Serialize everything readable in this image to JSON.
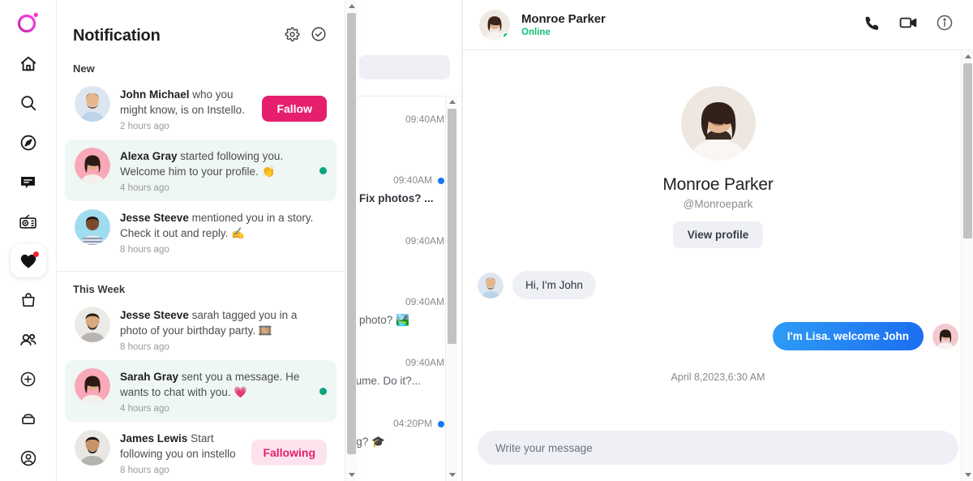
{
  "app": {
    "logo": "instello-logo",
    "accent": "#e51f6e",
    "unread_dot": "#0aa47e"
  },
  "rail": {
    "items": [
      {
        "name": "home",
        "icon": "home-icon",
        "badge": false
      },
      {
        "name": "search",
        "icon": "search-icon",
        "badge": false
      },
      {
        "name": "explore",
        "icon": "compass-icon",
        "badge": false
      },
      {
        "name": "messages",
        "icon": "chat-bubble-icon",
        "badge": false
      },
      {
        "name": "reels",
        "icon": "radio-icon",
        "badge": false
      },
      {
        "name": "notifications",
        "icon": "heart-icon",
        "badge": true
      },
      {
        "name": "shop",
        "icon": "shopping-bag-icon",
        "badge": false
      },
      {
        "name": "friends",
        "icon": "people-icon",
        "badge": false
      },
      {
        "name": "create",
        "icon": "plus-circle-icon",
        "badge": false
      },
      {
        "name": "saved",
        "icon": "archive-icon",
        "badge": false
      },
      {
        "name": "profile",
        "icon": "user-circle-icon",
        "badge": false
      }
    ]
  },
  "notification": {
    "title": "Notification",
    "settings_icon": "gear-icon",
    "markall_icon": "check-circle-icon",
    "sections": [
      {
        "label": "New",
        "items": [
          {
            "name": "John Michael",
            "text": " who you might know, is on Instello.",
            "time": "2 hours ago",
            "unread": false,
            "action": "Fallow",
            "action_type": "follow",
            "avatar": "avatar-john-michael"
          },
          {
            "name": "Alexa Gray",
            "text": " started following you. Welcome him to your profile. 👏",
            "time": "4 hours ago",
            "unread": true,
            "action": "",
            "action_type": "dot",
            "avatar": "avatar-alexa-gray"
          },
          {
            "name": "Jesse Steeve",
            "text": " mentioned you in a story. Check it out and reply. ✍️",
            "time": "8 hours ago",
            "unread": false,
            "action": "",
            "action_type": "none",
            "avatar": "avatar-jesse-steeve-1"
          }
        ]
      },
      {
        "label": "This Week",
        "items": [
          {
            "name": "Jesse Steeve",
            "text": " sarah tagged you in a photo of your birthday party. 🎞️",
            "time": "8 hours ago",
            "unread": false,
            "action": "",
            "action_type": "none",
            "avatar": "avatar-jesse-steeve-2"
          },
          {
            "name": "Sarah Gray",
            "text": " sent you a message. He wants to chat with you. 💗",
            "time": "4 hours ago",
            "unread": true,
            "action": "",
            "action_type": "dot",
            "avatar": "avatar-sarah-gray"
          },
          {
            "name": "James Lewis",
            "text": " Start following you on instello",
            "time": "8 hours ago",
            "unread": false,
            "action": "Fallowing",
            "action_type": "following",
            "avatar": "avatar-james-lewis"
          }
        ]
      }
    ]
  },
  "chat_list": {
    "search_placeholder": "",
    "items": [
      {
        "time": "09:40AM",
        "preview": "",
        "unread": false
      },
      {
        "time": "09:40AM",
        "preview": "Fix photos? ...",
        "unread": true
      },
      {
        "time": "09:40AM",
        "preview": "",
        "unread": false
      },
      {
        "time": "09:40AM",
        "preview": "ɔe photo? 🏞️",
        "unread": false
      },
      {
        "time": "09:40AM",
        "preview": "єsume. Do it?...",
        "unread": false
      },
      {
        "time": "04:20PM",
        "preview": "ting? 🎓",
        "unread": true
      }
    ]
  },
  "chat": {
    "header": {
      "name": "Monroe Parker",
      "status": "Online",
      "avatar": "avatar-monroe-parker-small",
      "icons": [
        "phone-icon",
        "video-camera-icon",
        "info-icon"
      ]
    },
    "profile": {
      "avatar": "avatar-monroe-parker-large",
      "name": "Monroe Parker",
      "handle": "@Monroepark",
      "view_profile_label": "View profile"
    },
    "messages": [
      {
        "side": "in",
        "text": "Hi, I'm John",
        "avatar": "avatar-john-small"
      },
      {
        "side": "out",
        "text": "I'm Lisa. welcome John",
        "avatar": "avatar-lisa-small"
      }
    ],
    "date_divider": "April 8,2023,6:30 AM",
    "composer_placeholder": "Write your message"
  }
}
